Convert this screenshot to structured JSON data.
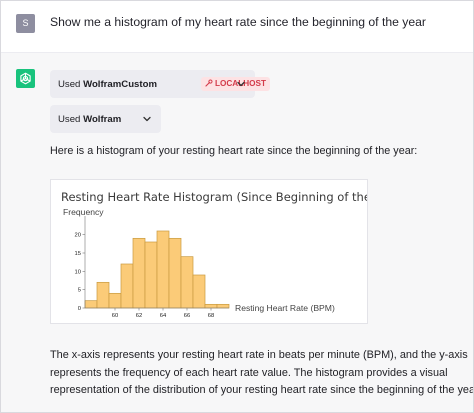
{
  "user": {
    "avatar_letter": "S",
    "message": "Show me a histogram of my heart rate since the beginning of the year"
  },
  "assistant": {
    "plugin_call_1": {
      "prefix": "Used ",
      "name": "WolframCustom",
      "badge": "LOCALHOST",
      "badge_icon": "wrench-icon"
    },
    "plugin_call_2": {
      "prefix": "Used ",
      "name": "Wolfram"
    },
    "intro": "Here is a histogram of your resting heart rate since the beginning of the year:",
    "explanation_lines": [
      "The x-axis represents your resting heart rate in beats per minute (BPM), and the y-axis",
      "represents the frequency of each heart rate value. The histogram provides a visual",
      "representation of the distribution of your resting heart rate since the beginning of the year."
    ]
  },
  "colors": {
    "assistant_avatar": "#19c37d",
    "bar_fill": "#fbcb78",
    "bar_stroke": "#c99a40",
    "badge_text": "#d33a4a",
    "badge_bg": "#fde2e4"
  },
  "chart_data": {
    "type": "bar",
    "title": "Resting Heart Rate Histogram (Since Beginning of the Year)",
    "xlabel": "Resting Heart Rate (BPM)",
    "ylabel": "Frequency",
    "bin_width": 1,
    "x": [
      58,
      59,
      60,
      61,
      62,
      63,
      64,
      65,
      66,
      67,
      68,
      69
    ],
    "values": [
      2,
      7,
      4,
      12,
      19,
      18,
      21,
      19,
      14,
      9,
      1,
      1
    ],
    "xlim": [
      57.5,
      69.5
    ],
    "ylim": [
      0,
      24
    ],
    "x_ticks": [
      "60",
      "62",
      "64",
      "66",
      "68"
    ],
    "y_ticks": [
      "0",
      "5",
      "10",
      "15",
      "20"
    ],
    "grid": false,
    "legend": "none"
  }
}
